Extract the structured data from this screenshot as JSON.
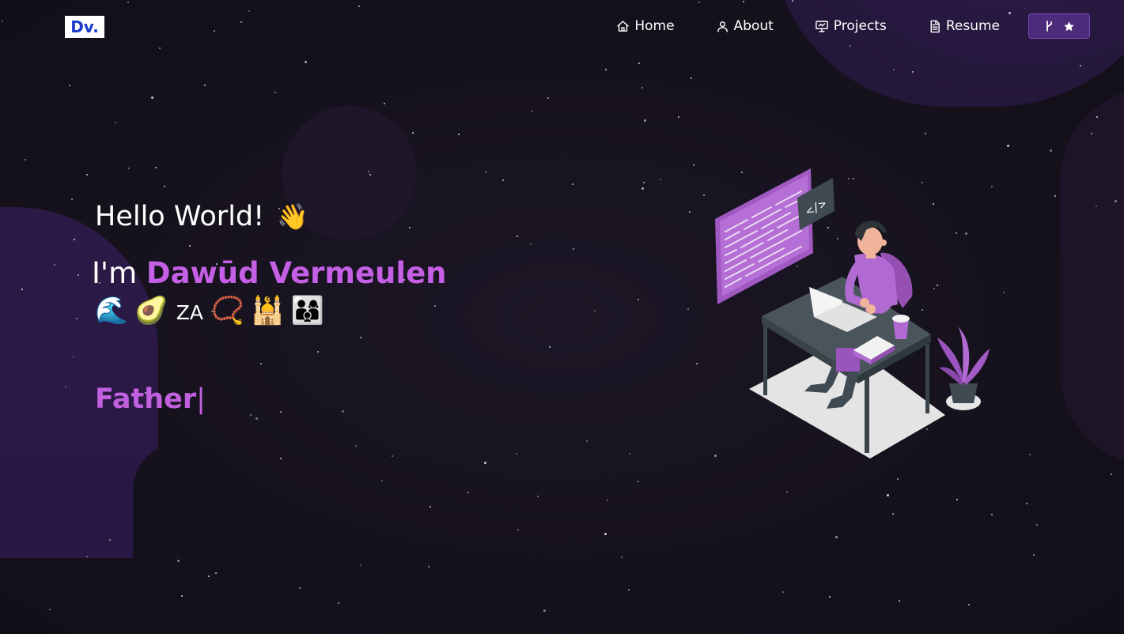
{
  "nav": {
    "logo": "Dv.",
    "items": [
      {
        "label": "Home",
        "icon": "home-icon"
      },
      {
        "label": "About",
        "icon": "user-icon"
      },
      {
        "label": "Projects",
        "icon": "presentation-icon"
      },
      {
        "label": "Resume",
        "icon": "document-icon"
      }
    ],
    "github_icons": [
      "git-fork-icon",
      "star-icon"
    ]
  },
  "hero": {
    "greeting": "Hello World!",
    "greeting_emoji": "👋",
    "intro_prefix": "I'm ",
    "name": "Dawūd Vermeulen",
    "emojis": [
      "🌊",
      "🥑"
    ],
    "country_code": "ZA",
    "emojis_after": [
      "📿",
      "🕌",
      "👨‍👩‍👦"
    ],
    "typed_text": "Father",
    "typed_cursor": "|"
  },
  "colors": {
    "accent": "#c55fe6",
    "background": "#17131f",
    "button": "#4b2b7a",
    "logo_text": "#1d3ccc"
  }
}
